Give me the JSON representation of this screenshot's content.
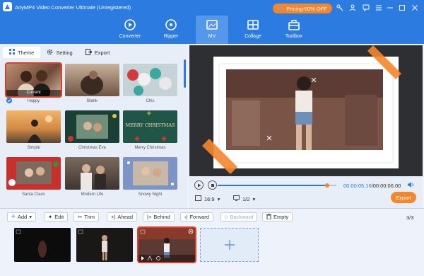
{
  "app": {
    "title": "AnyMP4 Video Converter Ultimate (Unregistered)",
    "pricing_label": "Pricing-50% OFF"
  },
  "nav": [
    {
      "label": "Converter"
    },
    {
      "label": "Ripper"
    },
    {
      "label": "MV"
    },
    {
      "label": "Collage"
    },
    {
      "label": "Toolbox"
    }
  ],
  "tabs": {
    "theme": "Theme",
    "setting": "Setting",
    "export": "Export"
  },
  "themes": [
    {
      "name": "Happy",
      "current_label": "Current"
    },
    {
      "name": "Blank"
    },
    {
      "name": "Chic"
    },
    {
      "name": "Simple"
    },
    {
      "name": "Christmas Eve"
    },
    {
      "name": "Merry Christmas",
      "thumb_text": "MERRY CHRISTMAS"
    },
    {
      "name": "Santa Claus"
    },
    {
      "name": "Modern Life"
    },
    {
      "name": "Snowy Night"
    }
  ],
  "player": {
    "current_time": "00:00:05.16",
    "total_time": "/00:00:06.00",
    "progress": 0.92,
    "aspect_ratio": "16:9",
    "screen": "1/2",
    "export_label": "Export"
  },
  "toolbar": {
    "add": "Add",
    "edit": "Edit",
    "trim": "Trim",
    "ahead": "Ahead",
    "behind": "Behind",
    "forward": "Forward",
    "backward": "Backward",
    "empty": "Empty",
    "page_count": "3/3"
  },
  "colors": {
    "accent": "#2c7be0",
    "orange": "#f5862a",
    "selected": "#e0402a"
  }
}
